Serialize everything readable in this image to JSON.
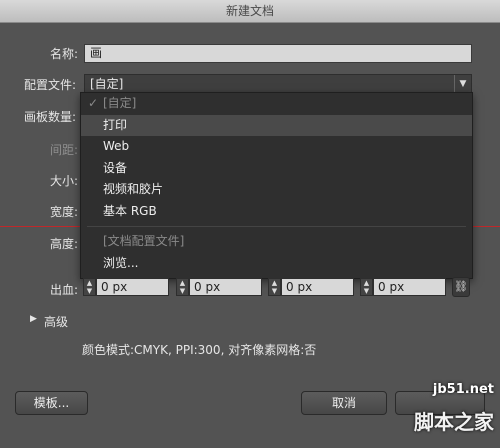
{
  "window_title": "新建文档",
  "form": {
    "name_label": "名称:",
    "name_value": "画",
    "profile_label": "配置文件:",
    "profile_value": "[自定]",
    "artboards_label": "画板数量:",
    "spacing_label": "间距:",
    "size_label": "大小:",
    "width_label": "宽度:",
    "height_label": "高度:",
    "bleed_label": "出血:",
    "bleed_values": [
      "0 px",
      "0 px",
      "0 px",
      "0 px"
    ]
  },
  "dropdown": {
    "items": [
      {
        "label": "[自定]",
        "checked": true,
        "disabled": true
      },
      {
        "label": "打印",
        "highlighted": true
      },
      {
        "label": "Web"
      },
      {
        "label": "设备"
      },
      {
        "label": "视频和胶片"
      },
      {
        "label": "基本 RGB"
      },
      {
        "label": "[文档配置文件]",
        "disabled": true,
        "separator_before": true
      },
      {
        "label": "浏览..."
      }
    ]
  },
  "advanced": {
    "label": "高级",
    "summary": "颜色模式:CMYK, PPI:300, 对齐像素网格:否"
  },
  "buttons": {
    "templates": "模板...",
    "cancel": "取消"
  },
  "watermark": {
    "line1": "jb51.net",
    "line2": "脚本之家"
  }
}
